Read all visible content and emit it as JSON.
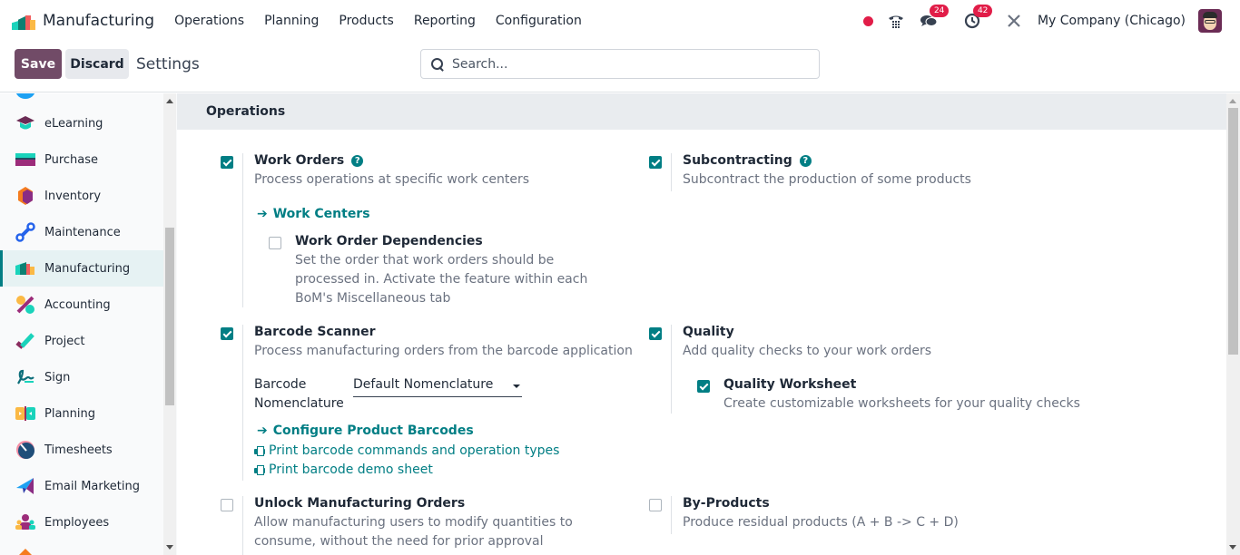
{
  "navbar": {
    "app_name": "Manufacturing",
    "menu": [
      "Operations",
      "Planning",
      "Products",
      "Reporting",
      "Configuration"
    ],
    "systray": {
      "status_dot_color": "#e11d48",
      "phone_icon": "phone-icon",
      "messages_badge": "24",
      "activities_badge": "42",
      "tools_icon": "tools-icon",
      "company": "My Company (Chicago)"
    }
  },
  "control_panel": {
    "save_label": "Save",
    "discard_label": "Discard",
    "title": "Settings",
    "search_placeholder": "Search..."
  },
  "sidebar": {
    "items": [
      {
        "label": "eLearning",
        "icon": "elearning-icon"
      },
      {
        "label": "Purchase",
        "icon": "purchase-icon"
      },
      {
        "label": "Inventory",
        "icon": "inventory-icon"
      },
      {
        "label": "Maintenance",
        "icon": "maintenance-icon"
      },
      {
        "label": "Manufacturing",
        "icon": "manufacturing-icon",
        "active": true
      },
      {
        "label": "Accounting",
        "icon": "accounting-icon"
      },
      {
        "label": "Project",
        "icon": "project-icon"
      },
      {
        "label": "Sign",
        "icon": "sign-icon"
      },
      {
        "label": "Planning",
        "icon": "planning-icon"
      },
      {
        "label": "Timesheets",
        "icon": "timesheets-icon"
      },
      {
        "label": "Email Marketing",
        "icon": "email-marketing-icon"
      },
      {
        "label": "Employees",
        "icon": "employees-icon"
      }
    ]
  },
  "section": {
    "title": "Operations",
    "settings": {
      "work_orders": {
        "title": "Work Orders",
        "checked": true,
        "description": "Process operations at specific work centers",
        "link": "Work Centers",
        "sub": {
          "title": "Work Order Dependencies",
          "checked": false,
          "description": "Set the order that work orders should be processed in. Activate the feature within each BoM's Miscellaneous tab"
        }
      },
      "subcontracting": {
        "title": "Subcontracting",
        "checked": true,
        "description": "Subcontract the production of some products"
      },
      "barcode": {
        "title": "Barcode Scanner",
        "checked": true,
        "description": "Process manufacturing orders from the barcode application",
        "field_label": "Barcode Nomenclature",
        "field_value": "Default Nomenclature",
        "link_configure": "Configure Product Barcodes",
        "link_print_commands": "Print barcode commands and operation types",
        "link_print_demo": "Print barcode demo sheet"
      },
      "quality": {
        "title": "Quality",
        "checked": true,
        "description": "Add quality checks to your work orders",
        "sub": {
          "title": "Quality Worksheet",
          "checked": true,
          "description": "Create customizable worksheets for your quality checks"
        }
      },
      "unlock": {
        "title": "Unlock Manufacturing Orders",
        "checked": false,
        "description": "Allow manufacturing users to modify quantities to consume, without the need for prior approval"
      },
      "byproducts": {
        "title": "By-Products",
        "checked": false,
        "description": "Produce residual products (A + B -> C + D)"
      }
    }
  },
  "colors": {
    "brand": "#714b67",
    "accent": "#017e84",
    "badge": "#e11d48"
  }
}
